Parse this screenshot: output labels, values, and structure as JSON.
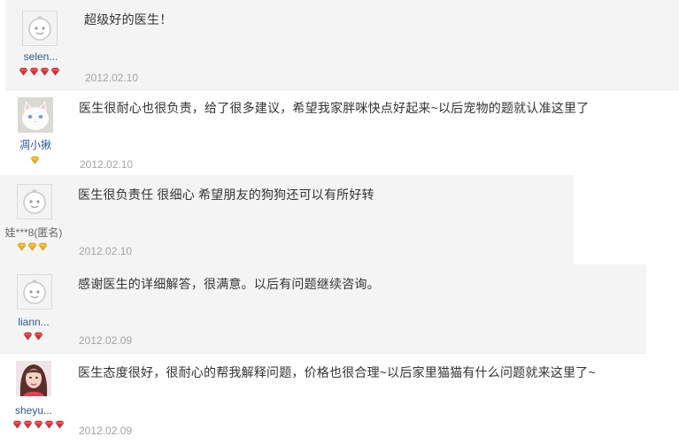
{
  "reviews": [
    {
      "user": "selen...",
      "avatar_icon": "default-baby-face-icon",
      "badge_type": "red-diamond",
      "badge_count": 4,
      "text": "超级好的医生！",
      "date": "2012.02.10"
    },
    {
      "user": "凋小揪",
      "avatar_icon": "white-cat-photo",
      "badge_type": "yellow-diamond",
      "badge_count": 1,
      "text": "医生很耐心也很负责，给了很多建议，希望我家胖咪快点好起来~以后宠物的题就认准这里了",
      "date": "2012.02.10"
    },
    {
      "user": "娃***8(匿名)",
      "avatar_icon": "default-baby-face-icon",
      "badge_type": "yellow-diamond",
      "badge_count": 3,
      "text": "医生很负责任 很细心 希望朋友的狗狗还可以有所好转",
      "date": "2012.02.10"
    },
    {
      "user": "liann...",
      "avatar_icon": "default-baby-face-icon",
      "badge_type": "red-diamond",
      "badge_count": 2,
      "text": "感谢医生的详细解答，很满意。以后有问题继续咨询。",
      "date": "2012.02.09"
    },
    {
      "user": "sheyu...",
      "avatar_icon": "woman-portrait-photo",
      "badge_type": "red-diamond",
      "badge_count": 5,
      "text": "医生态度很好，很耐心的帮我解释问题，价格也很合理~以后家里猫猫有什么问题就来这里了~",
      "date": "2012.02.09"
    }
  ],
  "colors": {
    "row_bg": "#f4f4f4",
    "username": "#2b5a8e",
    "anon_username": "#666666",
    "date": "#a3a3a3",
    "comment": "#333333",
    "red_badge": "#d8343a",
    "yellow_badge": "#f0b420"
  }
}
